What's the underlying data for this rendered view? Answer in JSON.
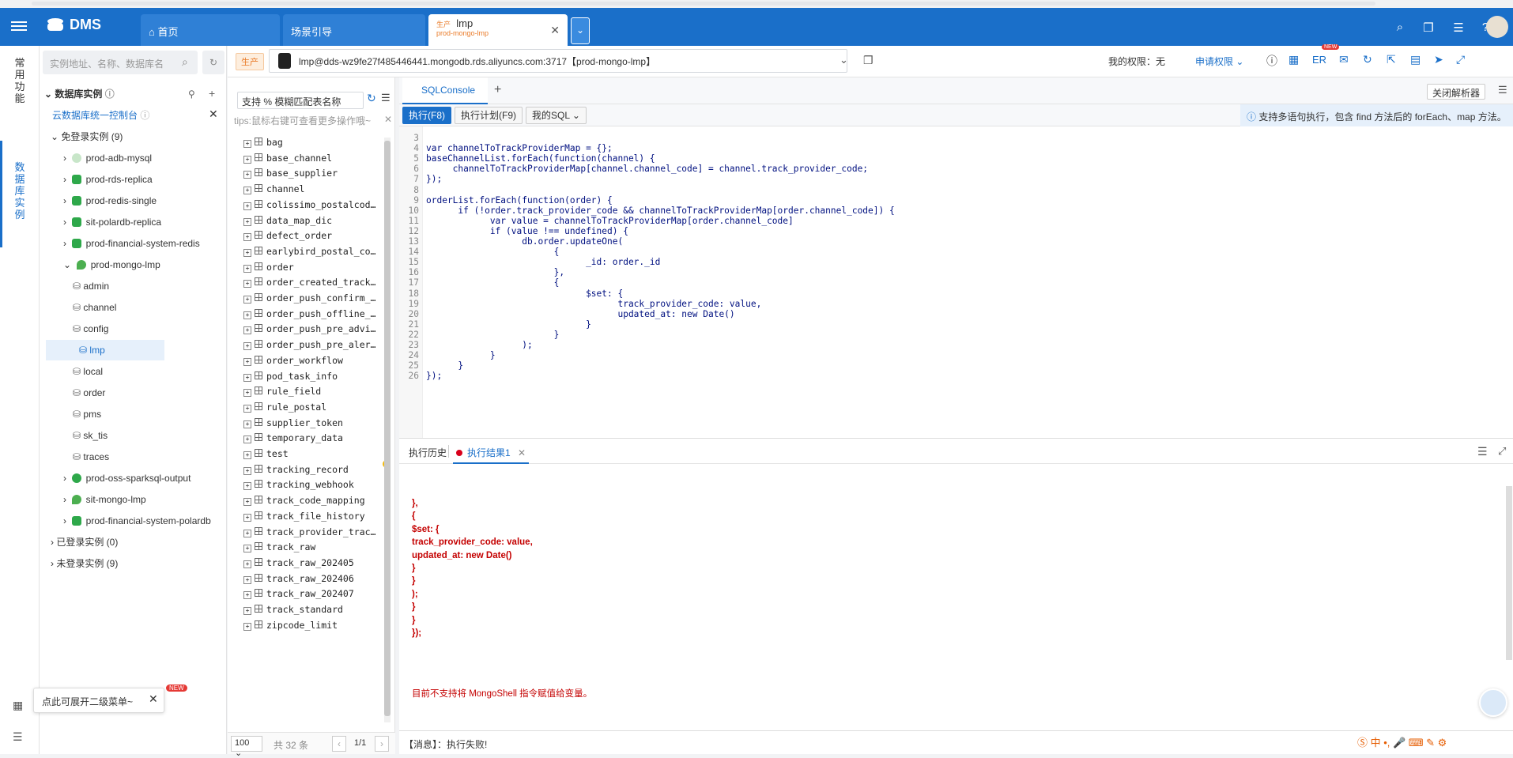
{
  "header": {
    "brand": "DMS",
    "tabs": [
      {
        "label": "首页"
      },
      {
        "label": "场景引导"
      },
      {
        "label": "lmp",
        "badge": "生产",
        "sub": "prod-mongo-lmp"
      }
    ]
  },
  "rail": {
    "items": [
      "常用功能",
      "数据库实例"
    ]
  },
  "instances": {
    "search_placeholder": "实例地址、名称、数据库名",
    "section_title": "数据库实例",
    "console_link": "云数据库统一控制台",
    "groups": {
      "free_login": "免登录实例 (9)",
      "logged_in": "已登录实例 (0)",
      "not_logged_in": "未登录实例 (9)"
    },
    "items": [
      {
        "label": "prod-adb-mysql"
      },
      {
        "label": "prod-rds-replica"
      },
      {
        "label": "prod-redis-single"
      },
      {
        "label": "sit-polardb-replica"
      },
      {
        "label": "prod-financial-system-redis"
      },
      {
        "label": "prod-mongo-lmp"
      },
      {
        "label": "prod-oss-sparksql-output"
      },
      {
        "label": "sit-mongo-lmp"
      },
      {
        "label": "prod-financial-system-polardb"
      }
    ],
    "databases": [
      "admin",
      "channel",
      "config",
      "lmp",
      "local",
      "order",
      "pms",
      "sk_tis",
      "traces"
    ],
    "selected_db": "lmp",
    "tooltip": "点此可展开二级菜单~",
    "new_badge": "NEW"
  },
  "connection": {
    "env": "生产",
    "address": "lmp@dds-wz9fe27f485446441.mongodb.rds.aliyuncs.com:3717【prod-mongo-lmp】",
    "permission": "我的权限：无",
    "apply": "申请权限",
    "er": "ER",
    "new": "NEW"
  },
  "tables": {
    "search_placeholder": "支持 % 模糊匹配表名称",
    "tips": "tips:鼠标右键可查看更多操作哦~",
    "items": [
      "bag",
      "base_channel",
      "base_supplier",
      "channel",
      "colissimo_postalcod…",
      "data_map_dic",
      "defect_order",
      "earlybird_postal_co…",
      "order",
      "order_created_track…",
      "order_push_confirm_…",
      "order_push_offline_…",
      "order_push_pre_advi…",
      "order_push_pre_aler…",
      "order_workflow",
      "pod_task_info",
      "rule_field",
      "rule_postal",
      "supplier_token",
      "temporary_data",
      "test",
      "tracking_record",
      "tracking_webhook",
      "track_code_mapping",
      "track_file_history",
      "track_provider_trac…",
      "track_raw",
      "track_raw_202405",
      "track_raw_202406",
      "track_raw_202407",
      "track_standard",
      "zipcode_limit"
    ],
    "page_size": "100",
    "total": "共 32 条",
    "page": "1/1"
  },
  "editor": {
    "tab": "SQLConsole",
    "close_parser": "关闭解析器",
    "execute": "执行(F8)",
    "plan": "执行计划(F9)",
    "my_sql": "我的SQL",
    "info": "支持多语句执行，包含 find 方法后的 forEach、map 方法。",
    "lines": [
      {
        "n": "3",
        "t": ""
      },
      {
        "n": "4",
        "t": "var channelToTrackProviderMap = {};"
      },
      {
        "n": "5",
        "t": "baseChannelList.forEach(function(channel) {"
      },
      {
        "n": "6",
        "t": "     channelToTrackProviderMap[channel.channel_code] = channel.track_provider_code;"
      },
      {
        "n": "7",
        "t": "});"
      },
      {
        "n": "8",
        "t": ""
      },
      {
        "n": "9",
        "t": "orderList.forEach(function(order) {"
      },
      {
        "n": "10",
        "t": "      if (!order.track_provider_code && channelToTrackProviderMap[order.channel_code]) {"
      },
      {
        "n": "11",
        "t": "            var value = channelToTrackProviderMap[order.channel_code]"
      },
      {
        "n": "12",
        "t": "            if (value !== undefined) {"
      },
      {
        "n": "13",
        "t": "                  db.order.updateOne("
      },
      {
        "n": "14",
        "t": "                        {"
      },
      {
        "n": "15",
        "t": "                              _id: order._id"
      },
      {
        "n": "16",
        "t": "                        },"
      },
      {
        "n": "17",
        "t": "                        {"
      },
      {
        "n": "18",
        "t": "                              $set: {"
      },
      {
        "n": "19",
        "t": "                                    track_provider_code: value,"
      },
      {
        "n": "20",
        "t": "                                    updated_at: new Date()"
      },
      {
        "n": "21",
        "t": "                              }"
      },
      {
        "n": "22",
        "t": "                        }"
      },
      {
        "n": "23",
        "t": "                  );"
      },
      {
        "n": "24",
        "t": "            }"
      },
      {
        "n": "25",
        "t": "      }"
      },
      {
        "n": "26",
        "t": "});"
      }
    ]
  },
  "result": {
    "history_tab": "执行历史",
    "result_tab": "执行结果1",
    "lines": [
      "},",
      "{",
      "$set: {",
      "track_provider_code: value,",
      "updated_at: new Date()",
      "}",
      "}",
      ");",
      "}",
      "}",
      "});"
    ],
    "error": "目前不支持将 MongoShell 指令赋值给变量。",
    "status": "【消息】：执行失败!"
  }
}
